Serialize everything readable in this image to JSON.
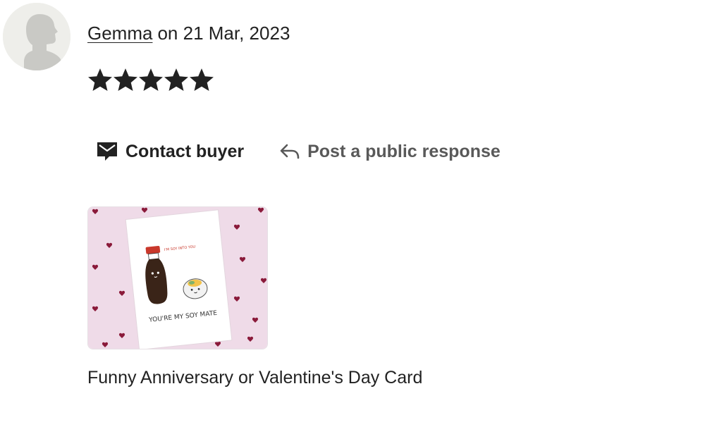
{
  "review": {
    "author": "Gemma",
    "date_prefix": "on",
    "date": "21 Mar, 2023",
    "rating": 5,
    "rating_max": 5
  },
  "actions": {
    "contact_label": "Contact buyer",
    "response_label": "Post a public response"
  },
  "product": {
    "title": "Funny Anniversary or Valentine's Day Card",
    "image_caption": "YOU'RE MY SOY MATE",
    "image_speech": "I'M SOY INTO YOU"
  },
  "icons": {
    "avatar": "person-silhouette-icon",
    "star": "star-icon",
    "contact": "mail-message-icon",
    "reply": "reply-arrow-icon"
  },
  "colors": {
    "text": "#222222",
    "muted": "#595959",
    "star": "#222222",
    "card_background": "#efdbe8",
    "heart": "#8a1a3a"
  }
}
